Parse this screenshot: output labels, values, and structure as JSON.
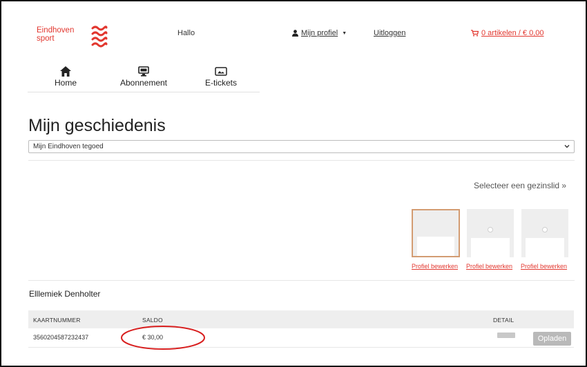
{
  "brand": {
    "line1": "Eindhoven",
    "line2": "sport",
    "color": "#e2372f"
  },
  "header": {
    "greeting": "Hallo",
    "profile_label": "Mijn profiel",
    "profile_icon": "user-icon",
    "logout_label": "Uitloggen",
    "cart_label": "0 artikelen / € 0,00",
    "cart_icon": "cart-icon"
  },
  "nav": {
    "items": [
      {
        "label": "Home",
        "icon": "home-icon"
      },
      {
        "label": "Abonnement",
        "icon": "monitor-icon"
      },
      {
        "label": "E-tickets",
        "icon": "ticket-icon"
      }
    ]
  },
  "page": {
    "title": "Mijn geschiedenis",
    "select_value": "Mijn Eindhoven tegoed"
  },
  "family": {
    "prompt": "Selecteer een gezinslid »",
    "members": [
      {
        "edit_label": "Profiel bewerken",
        "selected": true
      },
      {
        "edit_label": "Profiel bewerken",
        "selected": false
      },
      {
        "edit_label": "Profiel bewerken",
        "selected": false
      }
    ],
    "selected_color": "#d39c72"
  },
  "account": {
    "person_name": "Elllemiek Denholter",
    "table": {
      "columns": [
        "KAARTNUMMER",
        "SALDO",
        "DETAIL"
      ],
      "rows": [
        {
          "kaartnummer": "3560204587232437",
          "saldo": "€ 30,00",
          "action_label": "Opladen"
        }
      ]
    },
    "highlight_color": "#d81e1e"
  }
}
